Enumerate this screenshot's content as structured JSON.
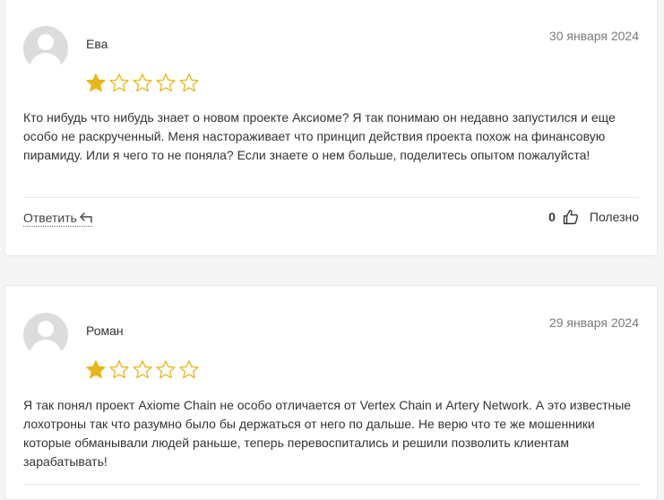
{
  "reviews": [
    {
      "author": "Ева",
      "date": "30 января 2024",
      "rating": 1,
      "max_rating": 5,
      "text": "Кто нибудь что нибудь знает о новом проекте Аксиоме? Я так понимаю он недавно запустился и еще особо не раскрученный. Меня настораживает что принцип действия проекта похож на финансовую пирамиду. Или я чего то не поняла? Если знаете о нем больше, поделитесь опытом пожалуйста!",
      "reply_label": "Ответить",
      "likes": "0",
      "helpful_label": "Полезно"
    },
    {
      "author": "Роман",
      "date": "29 января 2024",
      "rating": 1,
      "max_rating": 5,
      "text": "Я так понял проект Axiome Chain не особо отличается от Vertex Chain и Artery Network. А это известные лохотроны так что разумно было бы держаться от него по дальше. Не верю что те же мошенники которые обманывали людей раньше, теперь перевоспитались и решили позволить клиентам зарабатывать!"
    }
  ],
  "colors": {
    "star_filled": "#e8b51a",
    "star_outline": "#e8b51a",
    "avatar_bg": "#dcdcdc"
  },
  "icons": {
    "reply": "reply-arrow-icon",
    "helpful": "thumbs-up-icon",
    "star": "star-icon"
  }
}
